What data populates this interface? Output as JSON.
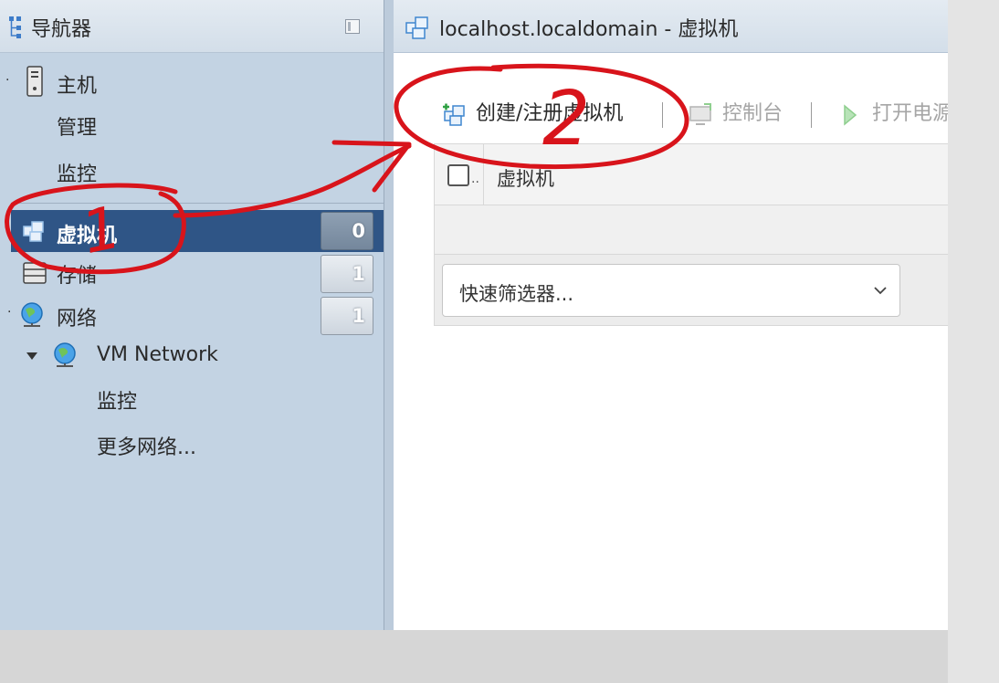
{
  "navigator": {
    "title": "导航器",
    "items": {
      "host": "主机",
      "manage": "管理",
      "monitor": "监控",
      "vms": "虚拟机",
      "storage": "存储",
      "network": "网络",
      "vm_network": "VM Network",
      "vm_network_monitor": "监控",
      "more_networks": "更多网络..."
    },
    "counts": {
      "vms": "0",
      "storage": "1",
      "network": "1"
    }
  },
  "main": {
    "title": "localhost.localdomain - 虚拟机",
    "toolbar": {
      "create": "创建/注册虚拟机",
      "console": "控制台",
      "power_on": "打开电源"
    },
    "grid": {
      "check_ellipsis": "..",
      "column": "虚拟机"
    },
    "filter": {
      "placeholder": "快速筛选器..."
    }
  },
  "annotations": {
    "marker_1": "1",
    "marker_2": "2"
  },
  "colors": {
    "selected": "#2f5586",
    "navigator_bg": "#c3d3e3",
    "annotation": "#d8141b"
  }
}
